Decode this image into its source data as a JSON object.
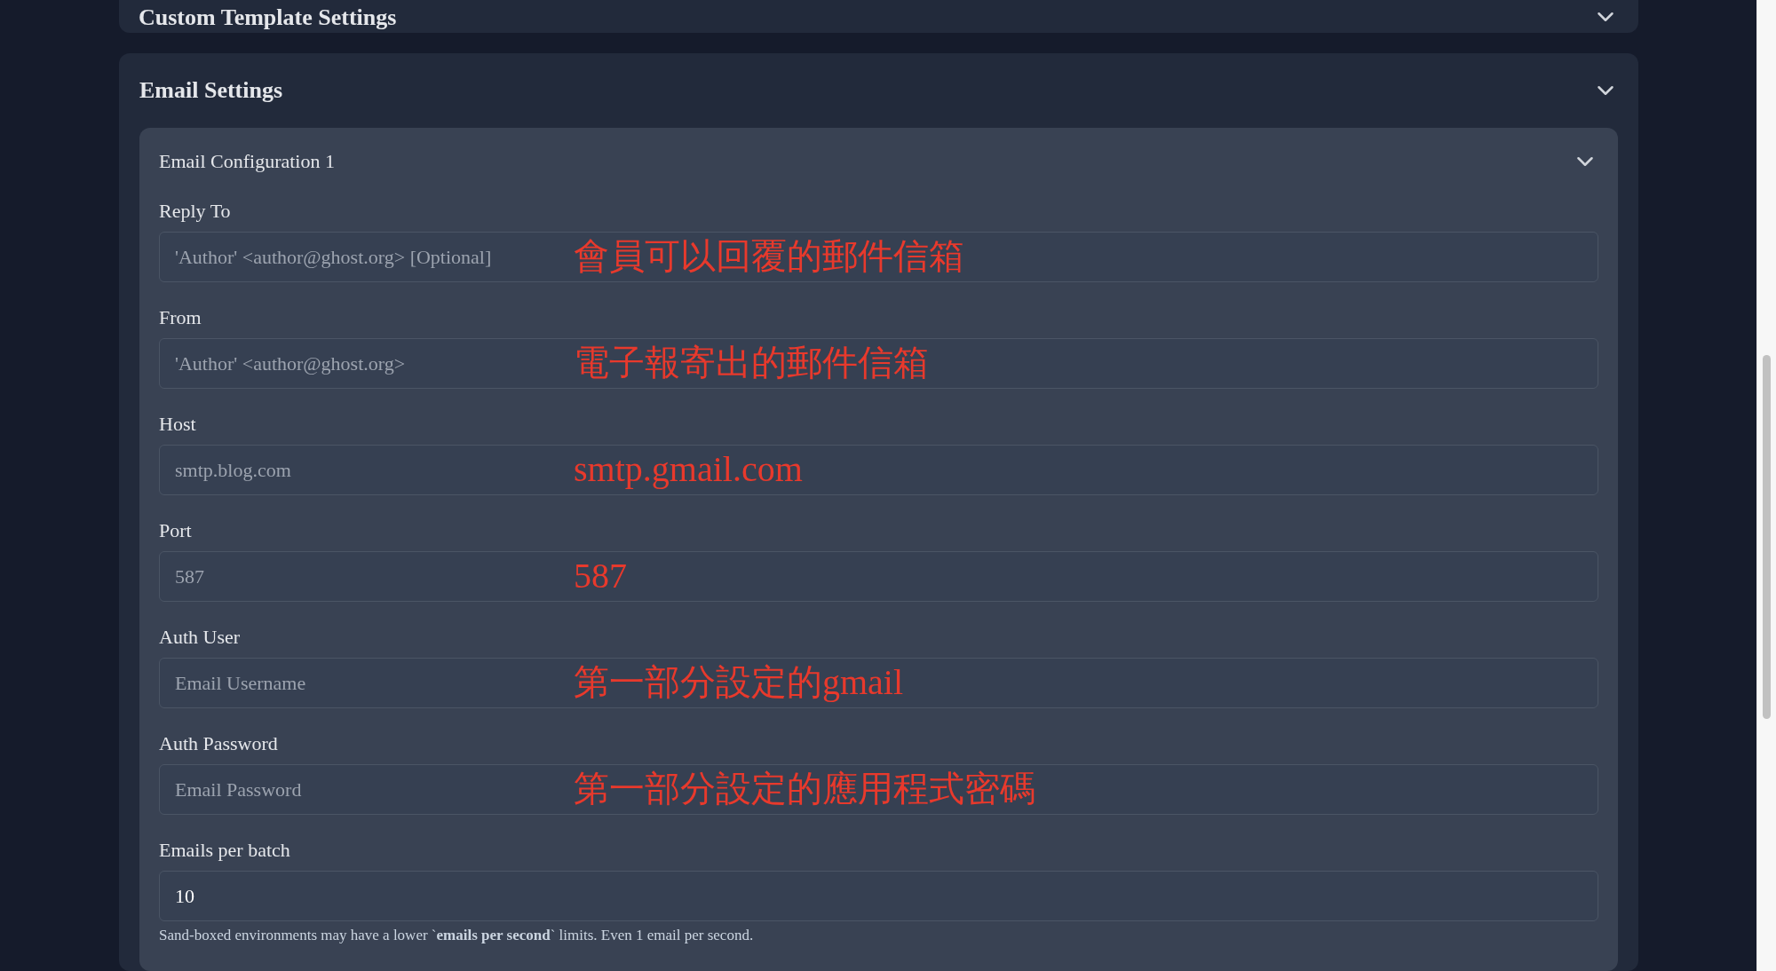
{
  "sections": [
    {
      "title": "Custom Template Settings"
    },
    {
      "title": "Email Settings",
      "configs": [
        {
          "title": "Email Configuration 1",
          "fields": [
            {
              "label": "Reply To",
              "placeholder": "'Author' <author@ghost.org> [Optional]",
              "annotation": "會員可以回覆的郵件信箱"
            },
            {
              "label": "From",
              "placeholder": "'Author' <author@ghost.org>",
              "annotation": "電子報寄出的郵件信箱"
            },
            {
              "label": "Host",
              "placeholder": "smtp.blog.com",
              "annotation": "smtp.gmail.com"
            },
            {
              "label": "Port",
              "placeholder": "587",
              "annotation": "587"
            },
            {
              "label": "Auth User",
              "placeholder": "Email Username",
              "annotation": "第一部分設定的gmail"
            },
            {
              "label": "Auth Password",
              "placeholder": "Email Password",
              "annotation": "第一部分設定的應用程式密碼"
            },
            {
              "label": "Emails per batch",
              "value": "10",
              "note": "Sand-boxed environments may have a lower `**emails per second**` limits. Even 1 email per second."
            }
          ]
        }
      ]
    }
  ]
}
